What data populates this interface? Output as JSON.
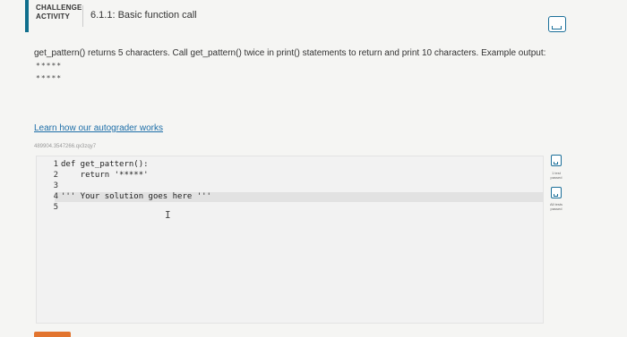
{
  "header": {
    "badge_line1": "CHALLENGE",
    "badge_line2": "ACTIVITY",
    "title": "6.1.1: Basic function call"
  },
  "instructions": "get_pattern() returns 5 characters. Call get_pattern() twice in print() statements to return and print 10 characters. Example output:",
  "example_output": [
    "*****",
    "*****"
  ],
  "learn_link": "Learn how our autograder works",
  "code_id": "489904.3547266.qx3zqy7",
  "editor": {
    "line_numbers": [
      "1",
      "2",
      "3",
      "4",
      "5"
    ],
    "lines": [
      "def get_pattern():",
      "    return '*****'",
      "",
      "''' Your solution goes here '''",
      ""
    ]
  },
  "tests": {
    "test1_label_line1": "1 test",
    "test1_label_line2": "passed",
    "test2_label_line1": "All tests",
    "test2_label_line2": "passed"
  },
  "colors": {
    "accent": "#0f6e8c",
    "link": "#1d6ea8",
    "check": "#1b6f99",
    "button": "#e2742e"
  },
  "icons": [
    "check-box-icon",
    "text-cursor-icon"
  ]
}
